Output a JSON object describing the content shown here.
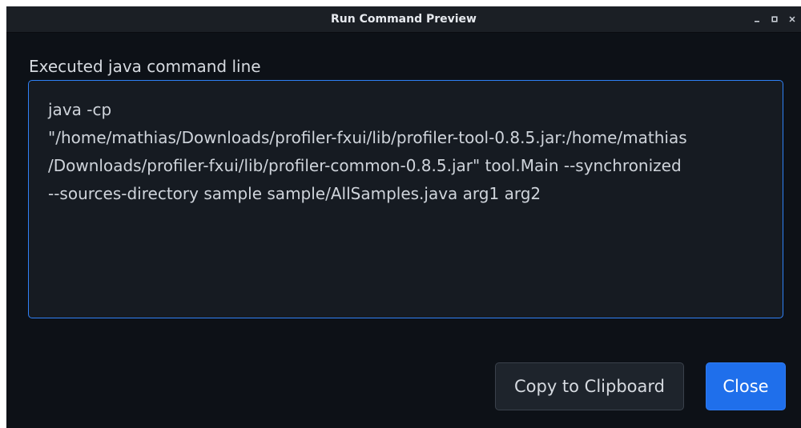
{
  "window": {
    "title": "Run Command Preview",
    "controls": {
      "minimize_icon": "minimize-icon",
      "maximize_icon": "maximize-icon",
      "close_icon": "close-icon"
    }
  },
  "main": {
    "label": "Executed java command line",
    "command": "java -cp\n\"/home/mathias/Downloads/profiler-fxui/lib/profiler-tool-0.8.5.jar:/home/mathias\n/Downloads/profiler-fxui/lib/profiler-common-0.8.5.jar\" tool.Main --synchronized\n--sources-directory sample sample/AllSamples.java arg1 arg2"
  },
  "buttons": {
    "copy_label": "Copy to Clipboard",
    "close_label": "Close"
  },
  "colors": {
    "background": "#0d1117",
    "titlebar": "#1b1f25",
    "accent": "#2f81f7",
    "primary_button": "#1f6feb"
  }
}
